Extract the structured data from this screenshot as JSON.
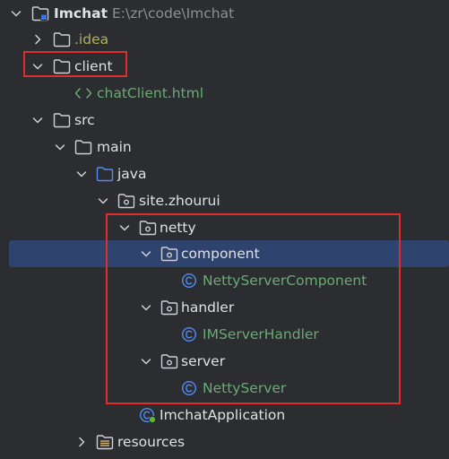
{
  "project": {
    "name": "Imchat",
    "path": "E:\\zr\\code\\Imchat"
  },
  "tree": {
    "idea": ".idea",
    "client": "client",
    "chat_client_html": "chatClient.html",
    "src": "src",
    "main": "main",
    "java": "java",
    "package": "site.zhourui",
    "netty": "netty",
    "component": "component",
    "netty_server_component": "NettyServerComponent",
    "handler": "handler",
    "im_server_handler": "IMServerHandler",
    "server": "server",
    "netty_server": "NettyServer",
    "imchat_application": "ImchatApplication",
    "resources": "resources"
  },
  "colors": {
    "background": "#2b2d30",
    "selection": "#2e436e",
    "highlight_border": "#e02d2d",
    "class_name_green": "#6aab73",
    "text": "#dfe1e5"
  },
  "icons": {
    "folder": "folder-icon",
    "module": "module-folder-icon",
    "package": "package-icon",
    "source_root": "source-root-icon",
    "resources_root": "resources-root-icon",
    "class": "class-icon",
    "html": "html-file-icon",
    "spring_app": "spring-class-icon",
    "chevron_down": "chevron-down-icon",
    "chevron_right": "chevron-right-icon"
  }
}
